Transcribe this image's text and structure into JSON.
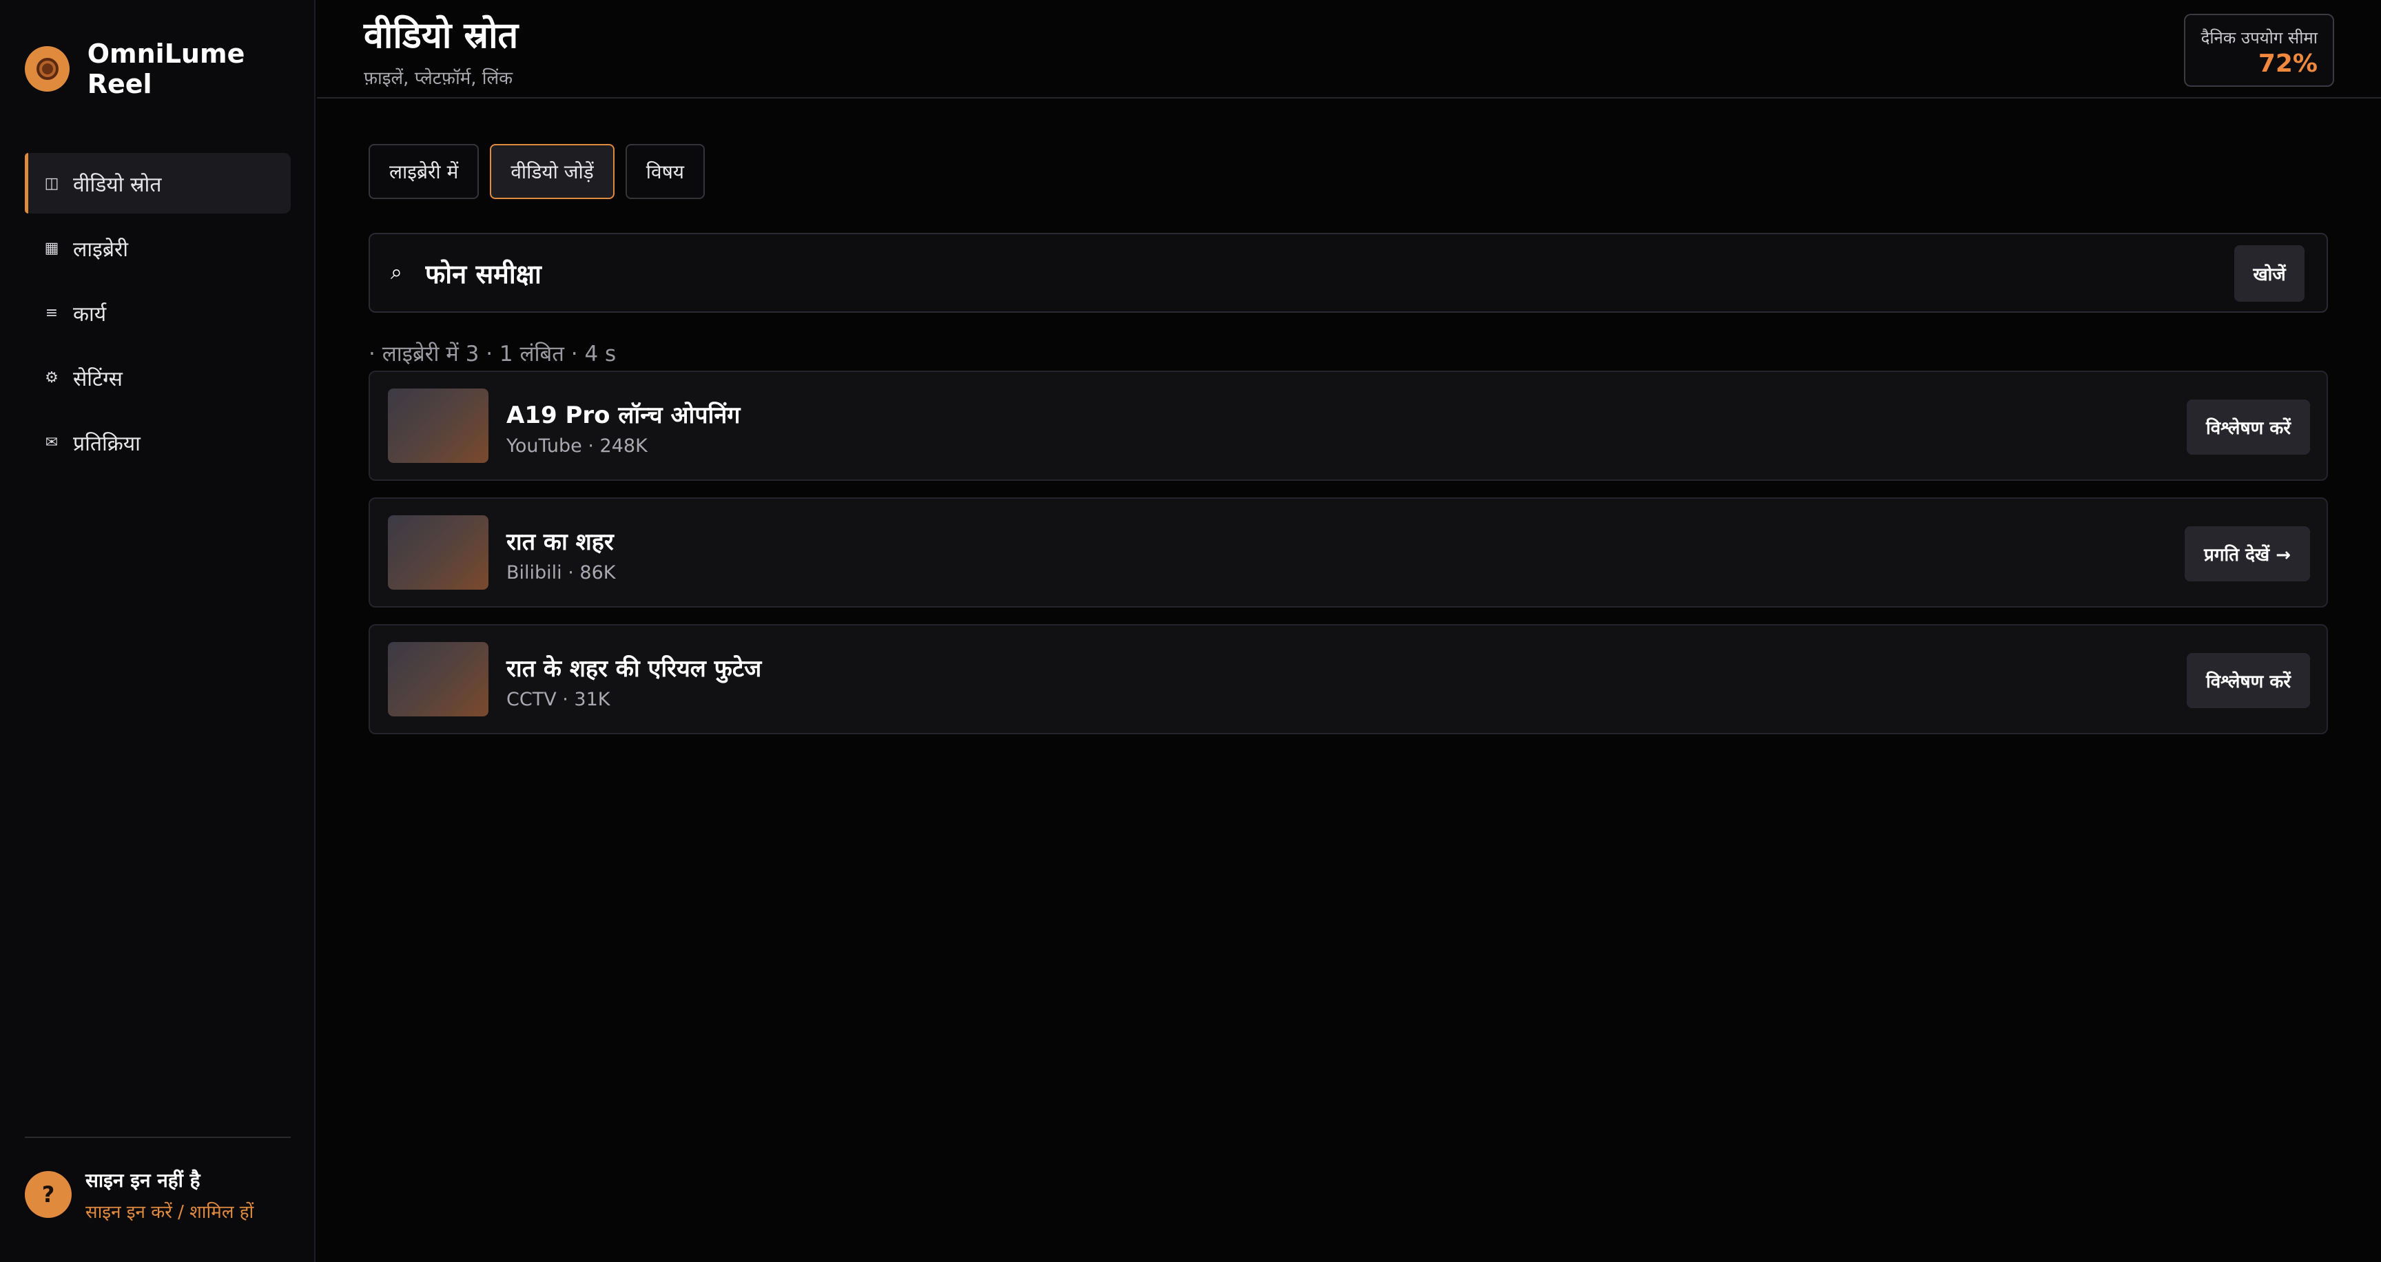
{
  "app": {
    "name": "OmniLume Reel"
  },
  "sidebar": {
    "items": [
      {
        "icon": "columns-icon",
        "glyph": "◫",
        "label": "वीडियो स्रोत",
        "active": true
      },
      {
        "icon": "library-icon",
        "glyph": "▦",
        "label": "लाइब्रेरी"
      },
      {
        "icon": "list-icon",
        "glyph": "≡",
        "label": "कार्य"
      },
      {
        "icon": "gear-icon",
        "glyph": "⚙",
        "label": "सेटिंग्स"
      },
      {
        "icon": "mail-icon",
        "glyph": "✉",
        "label": "प्रतिक्रिया"
      }
    ],
    "footer": {
      "avatar": "?",
      "title": "साइन इन नहीं है",
      "link": "साइन इन करें / शामिल हों"
    }
  },
  "header": {
    "title": "वीडियो स्रोत",
    "subtitle": "फ़ाइलें, प्लेटफ़ॉर्म, लिंक",
    "quota": {
      "label": "दैनिक उपयोग सीमा",
      "value": "72%"
    }
  },
  "tabs": [
    {
      "label": "लाइब्रेरी में"
    },
    {
      "label": "वीडियो जोड़ें",
      "active": true
    },
    {
      "label": "विषय"
    }
  ],
  "search": {
    "icon": "search-icon",
    "glyph": "⌕",
    "value": "फोन समीक्षा",
    "button_label": "खोजें"
  },
  "status": "· लाइब्रेरी में 3 · 1 लंबित · 4 s",
  "results": [
    {
      "title": "A19 Pro लॉन्च ओपनिंग",
      "meta": "YouTube · 248K",
      "action": "विश्लेषण करें"
    },
    {
      "title": "रात का शहर",
      "meta": "Bilibili · 86K",
      "action": "प्रगति देखें →"
    },
    {
      "title": "रात के शहर की एरियल फुटेज",
      "meta": "CCTV · 31K",
      "action": "विश्लेषण करें"
    }
  ],
  "colors": {
    "accent": "#e08a3e",
    "quota_value": "#f0883e",
    "background": "#050506",
    "panel": "#111114"
  }
}
